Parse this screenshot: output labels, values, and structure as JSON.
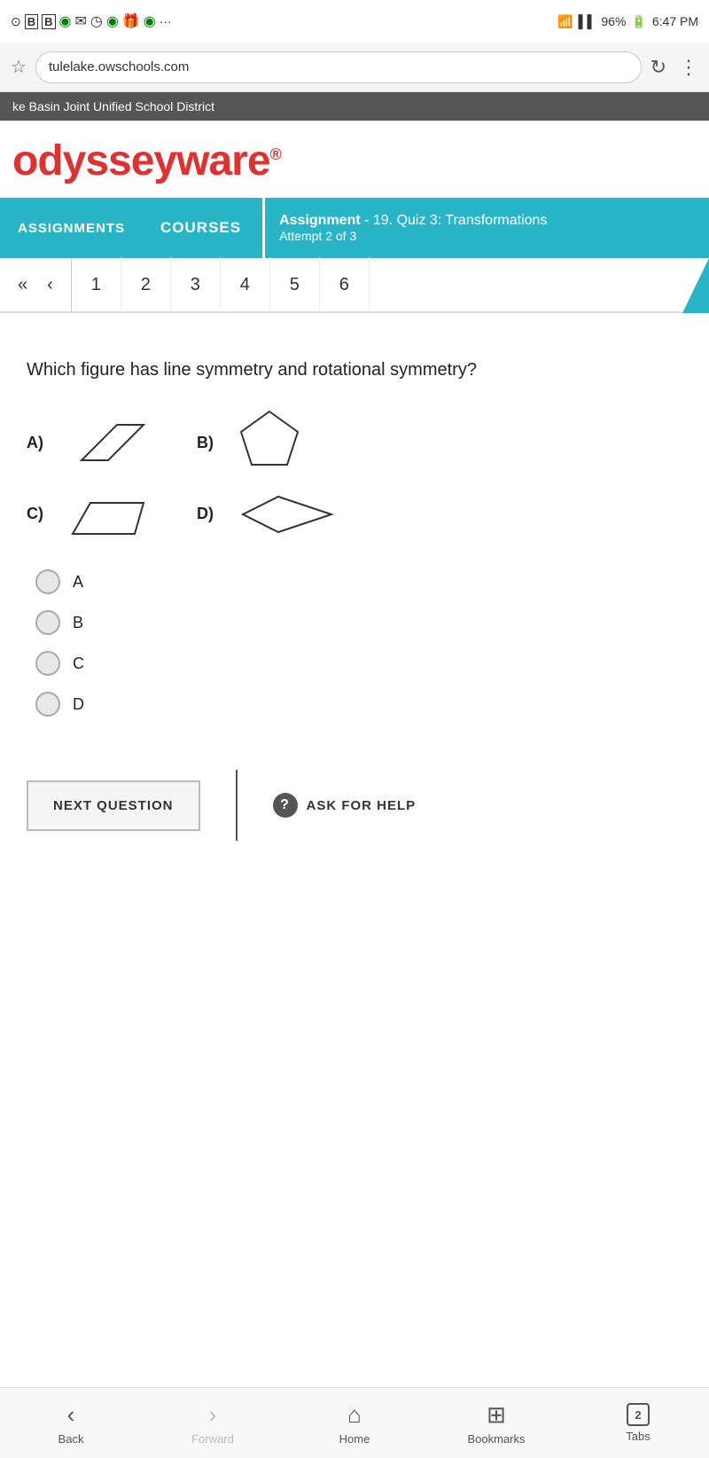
{
  "statusBar": {
    "time": "6:47 PM",
    "battery": "96%",
    "signal": "WiFi"
  },
  "browserBar": {
    "url": "tulelake.owschools.com"
  },
  "districtBanner": {
    "text": "ke Basin Joint Unified School District"
  },
  "logo": {
    "text": "odysseyware",
    "registered": "®"
  },
  "nav": {
    "assignments": "ASSIGNMENTS",
    "courses": "COURSES",
    "assignmentLabel": "Assignment",
    "assignmentTitle": " - 19. Quiz 3: Transformations",
    "attempt": "Attempt 2 of 3"
  },
  "pagination": {
    "pages": [
      "1",
      "2",
      "3",
      "4",
      "5",
      "6"
    ]
  },
  "question": {
    "text": "Which figure has line symmetry and rotational symmetry?"
  },
  "figures": {
    "rowA": {
      "label": "A)"
    },
    "rowB": {
      "label": "B)"
    },
    "rowC": {
      "label": "C)"
    },
    "rowD": {
      "label": "D)"
    }
  },
  "options": [
    {
      "letter": "A",
      "id": "opt-a"
    },
    {
      "letter": "B",
      "id": "opt-b"
    },
    {
      "letter": "C",
      "id": "opt-c"
    },
    {
      "letter": "D",
      "id": "opt-d"
    }
  ],
  "buttons": {
    "nextQuestion": "NEXT QUESTION",
    "askForHelp": "ASK FOR HELP"
  },
  "bottomNav": {
    "back": "Back",
    "forward": "Forward",
    "home": "Home",
    "bookmarks": "Bookmarks",
    "tabs": "Tabs",
    "tabCount": "2"
  }
}
